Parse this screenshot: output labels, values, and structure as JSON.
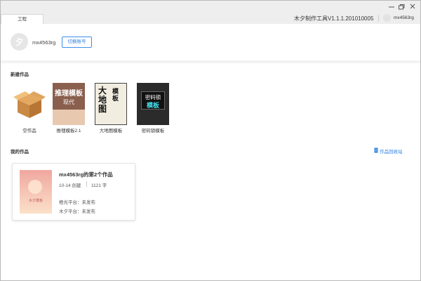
{
  "titlebar": {
    "tab_label": "工程",
    "app_version": "木夕制作工具V1.1.1.201010005",
    "username": "mx4563rg"
  },
  "account": {
    "username": "mx4563rg",
    "switch_label": "切换账号"
  },
  "new_works": {
    "title": "新建作品",
    "templates": [
      {
        "label": "空作品"
      },
      {
        "label": "推理模板2.1",
        "thumb_line1": "推理模板",
        "thumb_line2": "现代"
      },
      {
        "label": "大地图模板",
        "thumb_big": "大地图",
        "thumb_small": "模板"
      },
      {
        "label": "密码锁模板",
        "thumb_line1": "密码锁",
        "thumb_line2": "模板"
      }
    ]
  },
  "my_works": {
    "title": "我的作品",
    "backup_label": "作品回收站",
    "items": [
      {
        "title": "mx4563rg的第2个作品",
        "created": "10-14 创建",
        "words": "1121 字",
        "status1": "橙光平台：未发布",
        "status2": "木夕平台：未发布",
        "cover_text": "木夕模板"
      }
    ]
  },
  "colors": {
    "accent": "#2f7fe0",
    "tab_bg": "#ffffff",
    "page_bg": "#f3f3f3"
  }
}
